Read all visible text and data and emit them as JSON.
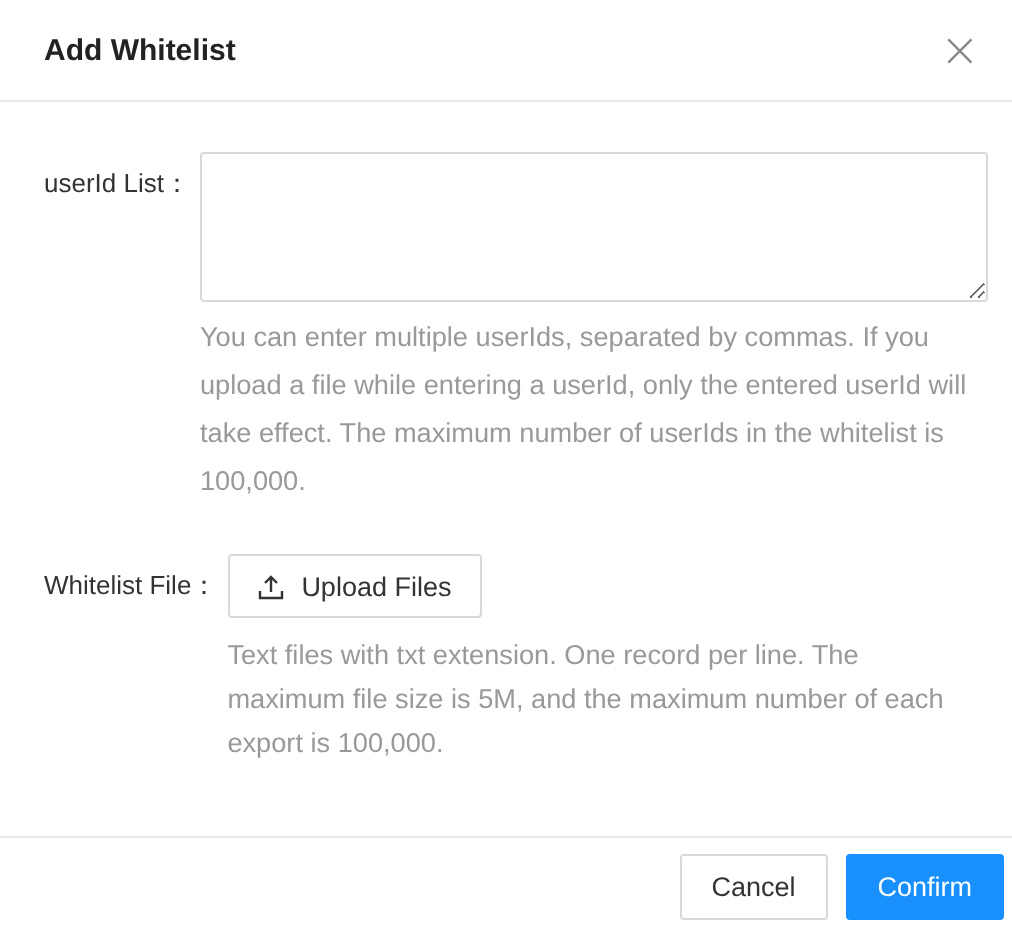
{
  "dialog": {
    "title": "Add Whitelist",
    "close_glyph": "×"
  },
  "fields": [
    {
      "kind": "textarea",
      "label": "userId List：",
      "help": "You can enter multiple userIds, separated by commas. If you upload a file while entering a userId, only the entered userId will take effect. The maximum number of userIds in the whitelist is 100,000."
    },
    {
      "kind": "upload",
      "label": "Whitelist File：",
      "button": "Upload Files",
      "help": "Text files with txt extension. One record per line. The maximum file size is 5M, and the maximum number of each export is 100,000."
    }
  ],
  "buttons": [
    {
      "label": "Cancel",
      "primary": false
    },
    {
      "label": "Confirm",
      "primary": true
    }
  ]
}
